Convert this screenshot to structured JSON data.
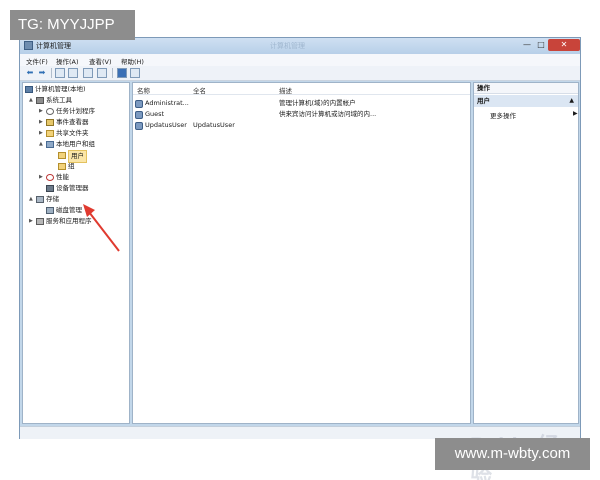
{
  "watermarks": {
    "top": "TG: MYYJJPP",
    "bottom": "www.m-wbty.com",
    "baidu": "Baidu 经验"
  },
  "window": {
    "title": "计算机管理",
    "title_blur": "计算机管理"
  },
  "menu": [
    "文件(F)",
    "操作(A)",
    "查看(V)",
    "帮助(H)"
  ],
  "toolbar": {
    "icons": [
      "back-arrow-icon",
      "forward-arrow-icon",
      "folder-icon",
      "list-icon",
      "refresh-icon",
      "export-icon",
      "help-icon",
      "view-icon"
    ]
  },
  "tree": [
    {
      "label": "计算机管理(本地)",
      "expand": "",
      "icon": "computer",
      "indent": 0
    },
    {
      "label": "系统工具",
      "expand": "▲",
      "icon": "tool",
      "indent": 1
    },
    {
      "label": "任务计划程序",
      "expand": "▶",
      "icon": "clock",
      "indent": 2
    },
    {
      "label": "事件查看器",
      "expand": "▶",
      "icon": "event",
      "indent": 2
    },
    {
      "label": "共享文件夹",
      "expand": "▶",
      "icon": "folder",
      "indent": 2
    },
    {
      "label": "本地用户和组",
      "expand": "▲",
      "icon": "users",
      "indent": 2
    },
    {
      "label": "用户",
      "expand": "",
      "icon": "folder",
      "indent": 3,
      "selected": true
    },
    {
      "label": "组",
      "expand": "",
      "icon": "folder",
      "indent": 3
    },
    {
      "label": "性能",
      "expand": "▶",
      "icon": "perf",
      "indent": 2
    },
    {
      "label": "设备管理器",
      "expand": "",
      "icon": "device",
      "indent": 2
    },
    {
      "label": "存储",
      "expand": "▲",
      "icon": "storage",
      "indent": 1
    },
    {
      "label": "磁盘管理",
      "expand": "",
      "icon": "disk",
      "indent": 2
    },
    {
      "label": "服务和应用程序",
      "expand": "▶",
      "icon": "service",
      "indent": 1
    }
  ],
  "table": {
    "headers": {
      "name": "名称",
      "fullname": "全名",
      "desc": "描述"
    },
    "rows": [
      {
        "name": "Administrat...",
        "fullname": "",
        "desc": "管理计算机(域)的内置帐户"
      },
      {
        "name": "Guest",
        "fullname": "",
        "desc": "供来宾访问计算机或访问域的内..."
      },
      {
        "name": "UpdatusUser",
        "fullname": "UpdatusUser",
        "desc": ""
      }
    ]
  },
  "actions": {
    "header": "操作",
    "section": "用户",
    "section_arrow": "▲",
    "more": "更多操作",
    "more_arrow": "▶"
  },
  "colors": {
    "arrow": "#e03a2f",
    "window_frame": "#c2d7ea",
    "selection": "#fbe6a8"
  }
}
